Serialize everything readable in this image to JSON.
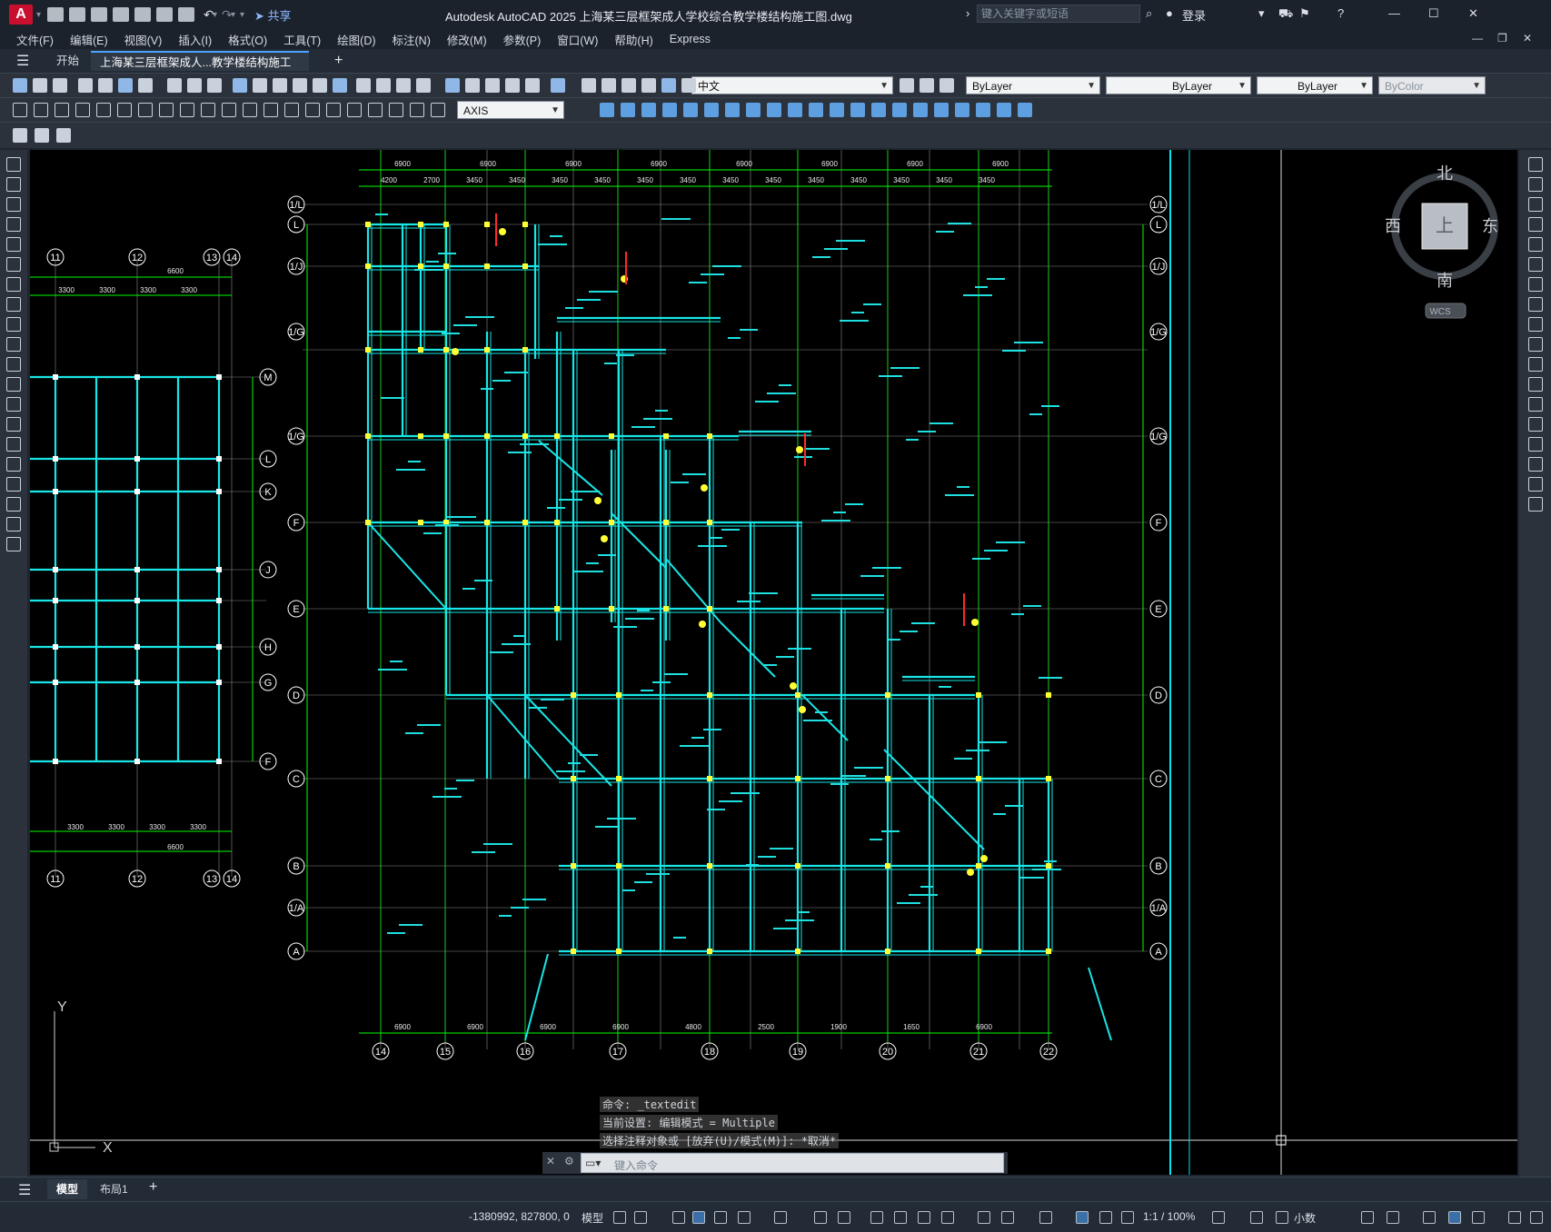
{
  "titlebar": {
    "app_logo": "A",
    "share_label": "共享",
    "title": "Autodesk AutoCAD 2025    上海某三层框架成人学校综合教学楼结构施工图.dwg",
    "search_placeholder": "键入关键字或短语",
    "login_label": "登录"
  },
  "menu": [
    "文件(F)",
    "编辑(E)",
    "视图(V)",
    "插入(I)",
    "格式(O)",
    "工具(T)",
    "绘图(D)",
    "标注(N)",
    "修改(M)",
    "参数(P)",
    "窗口(W)",
    "帮助(H)",
    "Express"
  ],
  "tabs": {
    "start": "开始",
    "active": "上海某三层框架成人...教学楼结构施工图*",
    "add": "+"
  },
  "toolbar": {
    "layer_name": "中文",
    "color": "ByLayer",
    "linetype": "ByLayer",
    "lineweight": "ByLayer",
    "plotstyle": "ByColor",
    "dimstyle": "AXIS"
  },
  "viewcube": {
    "north": "北",
    "south": "南",
    "east": "东",
    "west": "西",
    "face": "上",
    "wcs": "WCS"
  },
  "drawing": {
    "grid_left": [
      "11",
      "12",
      "13",
      "14"
    ],
    "rows_left": [
      "M",
      "L",
      "K",
      "J",
      "H",
      "G",
      "F"
    ],
    "grid_main": [
      "14",
      "15",
      "16",
      "17",
      "18",
      "19",
      "20",
      "21",
      "22"
    ],
    "rows_main": [
      "1/L",
      "L",
      "1/J",
      "1/G",
      "1/G",
      "F",
      "E",
      "D",
      "C",
      "B",
      "1/A",
      "A"
    ],
    "dims_top": [
      "6900",
      "6900",
      "6900",
      "6900",
      "6900",
      "6900",
      "6900",
      "6900"
    ],
    "dims_top2": [
      "4200",
      "2700",
      "3450",
      "3450",
      "3450",
      "3450",
      "3450",
      "3450",
      "3450",
      "3450",
      "3450",
      "3450",
      "3450",
      "3450",
      "3450"
    ],
    "dims_left_top": [
      "6600",
      "3300",
      "3300",
      "3300",
      "3300"
    ],
    "dims_left_bottom": [
      "3300",
      "3300",
      "3300",
      "3300",
      "6600"
    ],
    "dims_bottom": [
      "6900",
      "6900",
      "6900",
      "6900",
      "4800",
      "2500",
      "1900",
      "1650",
      "6900"
    ],
    "axis_y": "Y",
    "axis_x": "X"
  },
  "command": {
    "history": [
      "命令: _textedit",
      "当前设置: 编辑模式 = Multiple",
      "选择注释对象或 [放弃(U)/模式(M)]: *取消*"
    ],
    "placeholder": "键入命令"
  },
  "layouts": [
    "模型",
    "布局1"
  ],
  "status": {
    "coords": "-1380992, 827800, 0",
    "model": "模型",
    "scale": "1:1 / 100%",
    "units": "小数"
  }
}
